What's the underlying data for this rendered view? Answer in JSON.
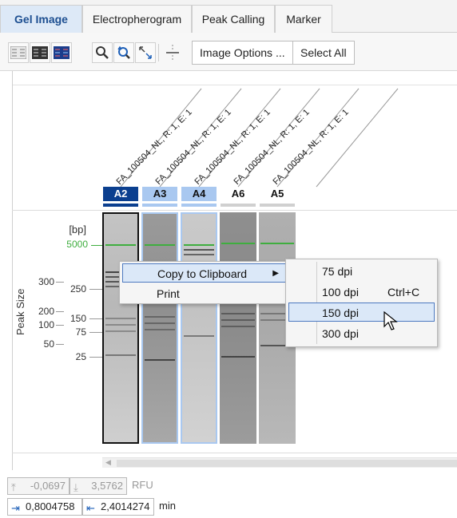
{
  "tabs": [
    {
      "label": "Gel Image",
      "active": true
    },
    {
      "label": "Electropherogram",
      "active": false
    },
    {
      "label": "Peak Calling",
      "active": false
    },
    {
      "label": "Marker",
      "active": false
    }
  ],
  "toolbar": {
    "image_options_label": "Image Options ...",
    "select_all_label": "Select All",
    "icons": [
      "gel-view-gray-icon",
      "gel-view-dark-icon",
      "gel-view-blue-icon",
      "zoom-icon",
      "zoom-reset-icon",
      "fit-icon",
      "split-view-icon"
    ]
  },
  "samples": [
    {
      "name": "FA_100504_NL, R: 1, E: 1",
      "well": "A2",
      "selected": "primary"
    },
    {
      "name": "FA_100504_NL, R: 1, E: 1",
      "well": "A3",
      "selected": "secondary"
    },
    {
      "name": "FA_100504_NL, R: 1, E: 1",
      "well": "A4",
      "selected": "secondary"
    },
    {
      "name": "FA_100504_NL, R: 1, E: 1",
      "well": "A6",
      "selected": "none"
    },
    {
      "name": "FA_100504_NL, R: 1, E: 1",
      "well": "A5",
      "selected": "none"
    }
  ],
  "axis": {
    "unit_label": "[bp]",
    "y_title": "Peak Size",
    "marker_label": "5000",
    "left_ticks": [
      "300",
      "200",
      "100",
      "50"
    ],
    "right_ticks": [
      "250",
      "150",
      "75",
      "25"
    ]
  },
  "context_menu": {
    "items": [
      {
        "label": "Copy to Clipboard",
        "submenu": true
      },
      {
        "label": "Print",
        "submenu": false
      }
    ],
    "submenu": [
      {
        "label": "75 dpi",
        "shortcut": ""
      },
      {
        "label": "100 dpi",
        "shortcut": "Ctrl+C"
      },
      {
        "label": "150 dpi",
        "shortcut": "",
        "highlighted": true
      },
      {
        "label": "300 dpi",
        "shortcut": ""
      }
    ]
  },
  "footer": {
    "rfu_min": "-0,0697",
    "rfu_max": "3,5762",
    "rfu_unit": "RFU",
    "time_min": "0,8004758",
    "time_max": "2,4014274",
    "time_unit": "min"
  },
  "colors": {
    "marker_green": "#3fae3f",
    "primary_selection": "#0b3f8f",
    "secondary_selection": "#a9c8f0"
  }
}
